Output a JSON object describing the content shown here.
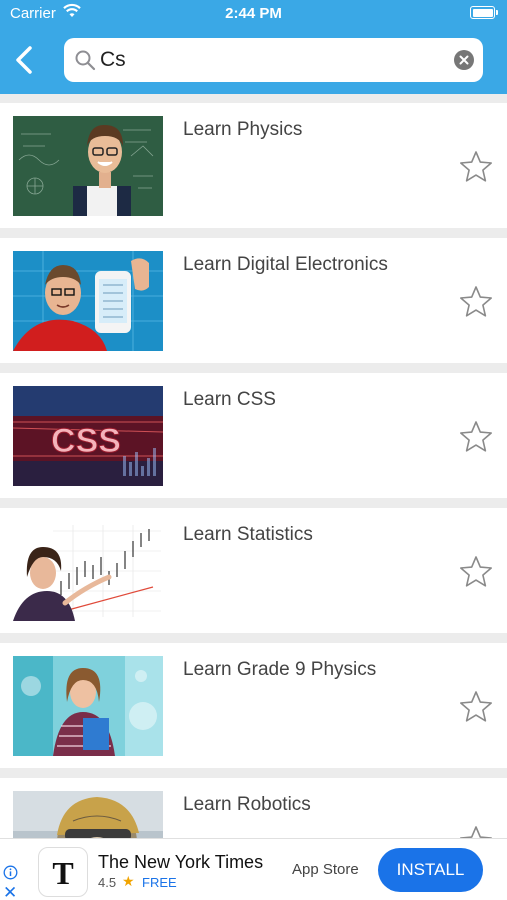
{
  "status_bar": {
    "carrier": "Carrier",
    "time": "2:44 PM"
  },
  "search": {
    "query": "Cs"
  },
  "results": [
    {
      "title": "Learn Physics"
    },
    {
      "title": "Learn Digital Electronics"
    },
    {
      "title": "Learn CSS",
      "thumbnail_text": "CSS"
    },
    {
      "title": "Learn Statistics"
    },
    {
      "title": "Learn Grade 9 Physics"
    },
    {
      "title": "Learn Robotics"
    }
  ],
  "ad": {
    "app_name": "The New York Times",
    "rating": "4.5",
    "price": "FREE",
    "store": "App Store",
    "cta": "INSTALL",
    "close_glyph": "✕"
  },
  "colors": {
    "header": "#3aa8e6",
    "install": "#1a73e8",
    "star_outline": "#8a8a8a"
  },
  "icons": [
    "wifi-icon",
    "battery-icon",
    "back-chevron-icon",
    "search-icon",
    "clear-icon",
    "star-outline-icon",
    "ad-info-icon",
    "close-icon"
  ]
}
